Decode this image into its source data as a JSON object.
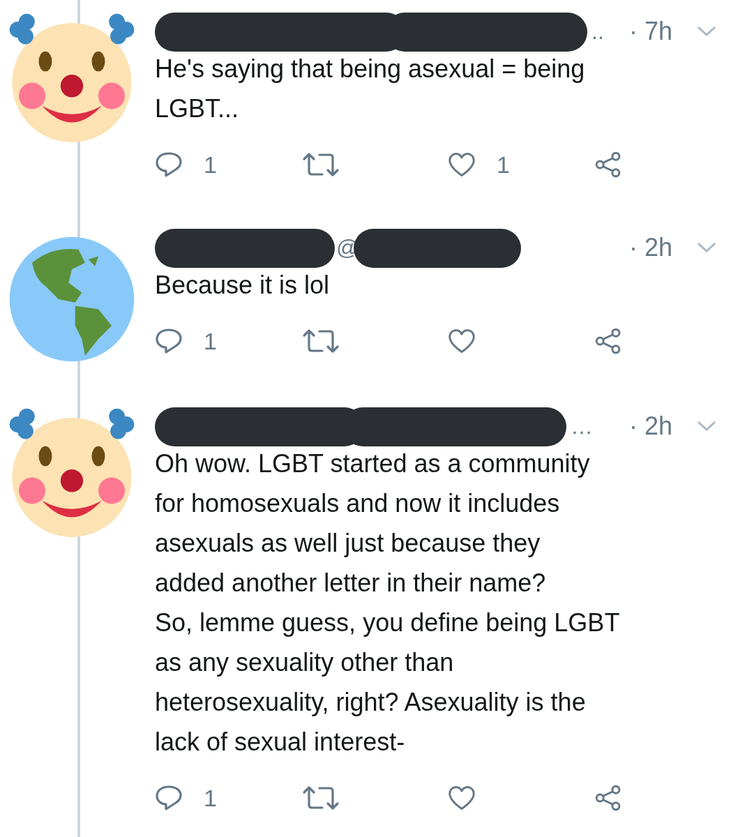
{
  "tweets": [
    {
      "avatar": {
        "kind": "clown"
      },
      "name_tail": "..",
      "time": "· 7h",
      "text": "He's saying that being asexual = being\nLGBT...",
      "reply_count": "1",
      "like_count": "1"
    },
    {
      "avatar": {
        "kind": "globe"
      },
      "name_tail": "@",
      "time": "· 2h",
      "text": "Because it is lol",
      "reply_count": "1"
    },
    {
      "avatar": {
        "kind": "clown"
      },
      "name_tail": "…",
      "time": "· 2h",
      "text": "Oh wow. LGBT started as a community\nfor homosexuals and now it includes\nasexuals as well just because they\nadded another letter in their name?\nSo, lemme guess, you define being LGBT\nas any sexuality other than\nheterosexuality, right? Asexuality is the\nlack of sexual interest-",
      "reply_count": "1"
    }
  ]
}
